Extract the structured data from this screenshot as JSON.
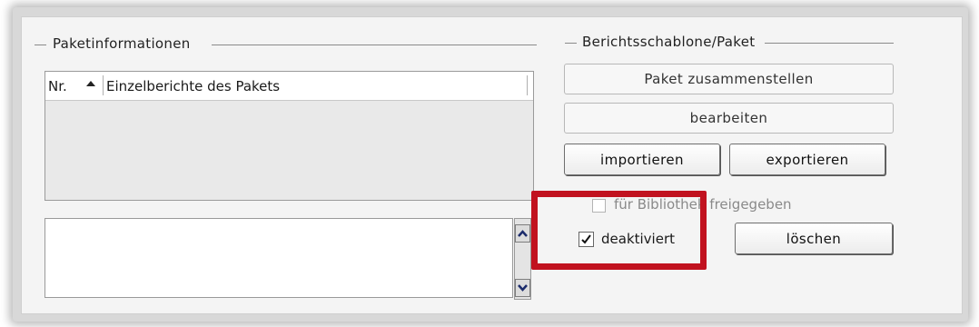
{
  "package_info": {
    "legend": "Paketinformationen",
    "columns": {
      "nr": "Nr.",
      "reports": "Einzelberichte des Pakets"
    }
  },
  "template_package": {
    "legend": "Berichtsschablone/Paket",
    "assemble_label": "Paket zusammenstellen",
    "edit_label": "bearbeiten",
    "import_label": "importieren",
    "export_label": "exportieren",
    "library_label": "für Bibliothek freigegeben",
    "library_checked": false,
    "deactivated_label": "deaktiviert",
    "deactivated_checked": true,
    "delete_label": "löschen"
  },
  "colors": {
    "highlight": "#c1121f",
    "panel_bg": "#f4f4f4",
    "list_bg": "#e9e9e9"
  }
}
